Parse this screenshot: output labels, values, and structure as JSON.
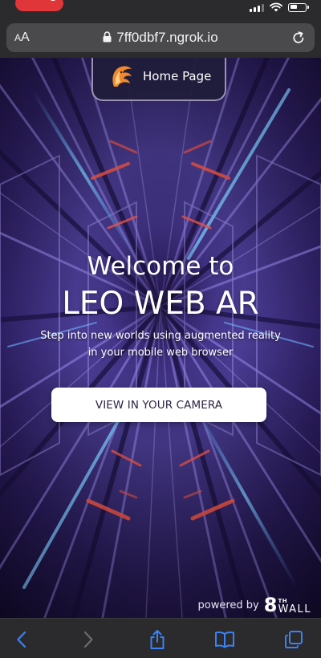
{
  "browser": {
    "reader_big": "A",
    "reader_small": "A",
    "url": "7ff0dbf7.ngrok.io"
  },
  "nav": {
    "home_label": "Home Page"
  },
  "hero": {
    "welcome": "Welcome to",
    "title": "LEO WEB AR",
    "subtitle_line1": "Step into new worlds using augmented reality",
    "subtitle_line2": "in your mobile web browser",
    "cta": "VIEW IN YOUR CAMERA"
  },
  "footer": {
    "powered_by": "powered by",
    "brand_eight": "8",
    "brand_th": "TH",
    "brand_wall": "WALL"
  },
  "colors": {
    "accent_purple": "#6b5bd0",
    "background_dark": "#1c1140",
    "recording_red": "#e0363a",
    "ios_blue": "#3b82f6",
    "button_text": "#2c2442"
  },
  "icons": [
    "recording-icon",
    "signal-icon",
    "wifi-icon",
    "battery-icon",
    "lock-icon",
    "reload-icon",
    "leo-logo-icon",
    "back-icon",
    "forward-icon",
    "share-icon",
    "bookmarks-icon",
    "tabs-icon"
  ]
}
